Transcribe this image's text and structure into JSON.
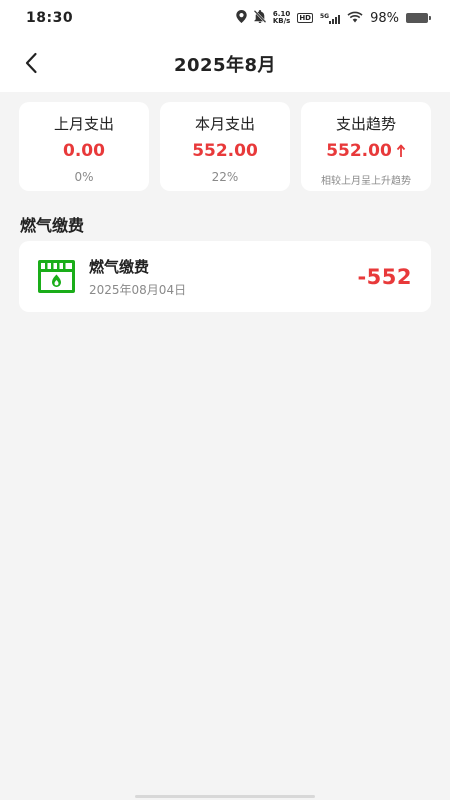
{
  "status_bar": {
    "time": "18:30",
    "net_speed_value": "6.10",
    "net_speed_unit": "KB/s",
    "hd_label": "HD",
    "signal_label": "5G",
    "battery": "98%"
  },
  "nav": {
    "title": "2025年8月"
  },
  "summary": {
    "last_month": {
      "title": "上月支出",
      "value": "0.00",
      "sub": "0%"
    },
    "this_month": {
      "title": "本月支出",
      "value": "552.00",
      "sub": "22%"
    },
    "trend": {
      "title": "支出趋势",
      "value": "552.00",
      "sub": "相较上月呈上升趋势"
    }
  },
  "section": {
    "title": "燃气缴费"
  },
  "records": [
    {
      "name": "燃气缴费",
      "date": "2025年08月04日",
      "amount": "-552"
    }
  ],
  "colors": {
    "accent_red": "#e8393a",
    "gas_icon_green": "#1aad19"
  },
  "icons": {
    "back": "chevron-left-icon",
    "location": "location-icon",
    "mute": "bell-off-icon",
    "wifi": "wifi-icon",
    "battery": "battery-icon",
    "trend": "arrow-up-icon",
    "gas": "gas-meter-icon"
  }
}
